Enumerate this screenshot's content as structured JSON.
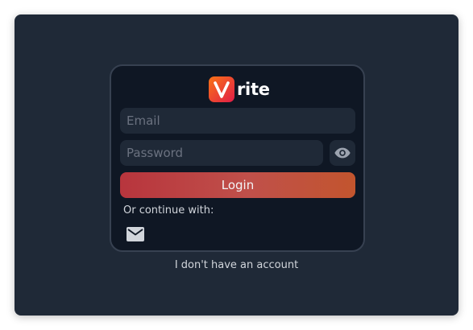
{
  "app": {
    "logo_text": "rite",
    "logo_letter": "V",
    "brand_gradient": [
      "#f97316",
      "#e11d48"
    ]
  },
  "form": {
    "email_placeholder": "Email",
    "email_value": "",
    "password_placeholder": "Password",
    "password_value": "",
    "login_label": "Login",
    "continue_label": "Or continue with:",
    "providers": [
      {
        "name": "email",
        "icon": "mail-icon"
      }
    ]
  },
  "footer": {
    "account_link": "I don't have an account"
  },
  "colors": {
    "window_bg": "#1f2937",
    "card_bg": "#0f1724",
    "field_bg": "#1f2937",
    "login_gradient": [
      "#b8353d",
      "#c2552e"
    ]
  }
}
